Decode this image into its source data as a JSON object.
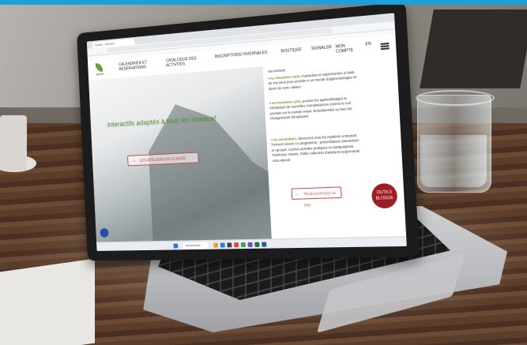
{
  "scene": {
    "accent_color": "#1e9fd8"
  },
  "browser": {
    "tab_title": "Guepe - Accueil"
  },
  "site": {
    "logo_text": "guepe",
    "nav": [
      {
        "label": "CALENDRIER ET RÉSERVATIONS"
      },
      {
        "label": "CATALOGUE DES ACTIVITÉS"
      },
      {
        "label": "INSCRIPTIONS HIVERNALES"
      },
      {
        "label": "BOUTIQUE"
      },
      {
        "label": "SIGNALER"
      },
      {
        "label": "MON COMPTE"
      },
      {
        "label": "EN"
      }
    ],
    "hero_title": "interactifs adaptés à tous les niveaux!",
    "hero_button": "LES ATELIERS EN CLASSE",
    "content_intro": "vos besoins.",
    "bullets": [
      {
        "strong": "Au deuxième cycle",
        "text": ", manipules et expérimentes à l'aide de vos sens pour accéder à un monde d'apprentissages en direct de votre classe!"
      },
      {
        "strong": "Au troisième cycle",
        "text": ", pousse les apprentissages et introduisez de nouvelles connaissances comme le voir pousser sur le monde vivant, la biodiversité ou bien les changements climatiques!"
      },
      {
        "strong": "Au secondaire",
        "text": ", découvrez tous les mystères entourant l'univers vivant! Au programme : présentations interactives en groupe, courtes activités pratiques et manipulations d'animaux vivants. Petite collection d'artefacts surprenante vous attend!"
      }
    ],
    "download_button": "TÉLÉCHARGEZ LE PDF",
    "badge": {
      "line1": "OUTILS",
      "line2": "BLOGUE"
    }
  },
  "taskbar": {
    "search_label": "Rechercher"
  }
}
